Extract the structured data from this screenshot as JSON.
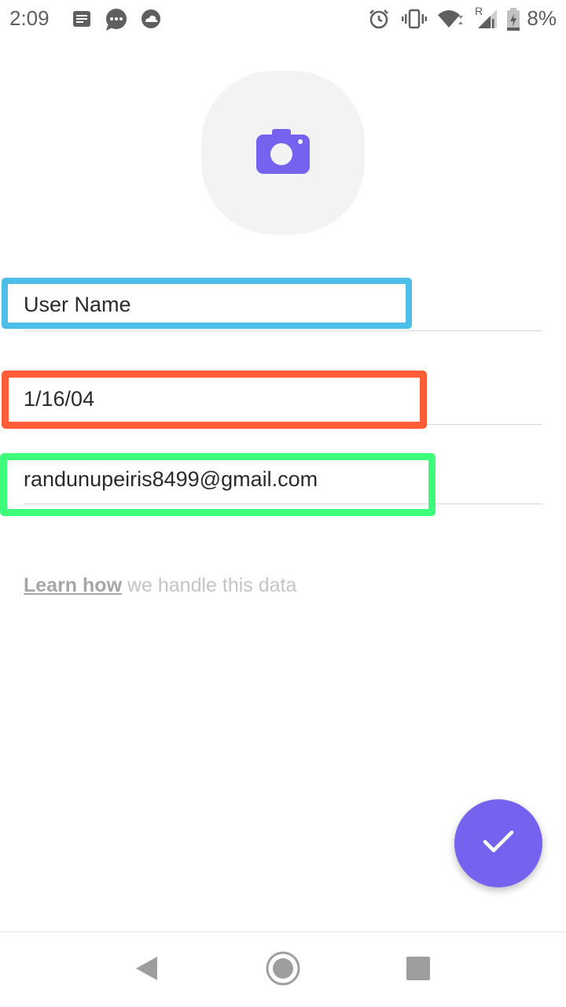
{
  "status_bar": {
    "time": "2:09",
    "battery_percent": "8%",
    "notification_icons": [
      "notes-icon",
      "chat-bubble-icon",
      "cloud-icon"
    ],
    "system_icons": [
      "alarm-icon",
      "vibrate-icon",
      "wifi-icon",
      "signal-icon",
      "battery-icon"
    ],
    "roaming_indicator": "R"
  },
  "avatar": {
    "icon": "camera-icon",
    "accent_color": "#7563ef"
  },
  "form": {
    "name": {
      "value": "User Name",
      "highlight_color": "#4dbde9"
    },
    "birthdate": {
      "value": "1/16/04",
      "highlight_color": "#ff5d38"
    },
    "email": {
      "value": "randunupeiris8499@gmail.com",
      "highlight_color": "#3dfd7b"
    }
  },
  "privacy": {
    "link_text": "Learn how",
    "rest_text": " we handle this data"
  },
  "fab": {
    "icon": "check-icon",
    "color": "#7563ef"
  },
  "nav_bar": {
    "buttons": [
      "back-icon",
      "home-icon",
      "recents-icon"
    ]
  }
}
